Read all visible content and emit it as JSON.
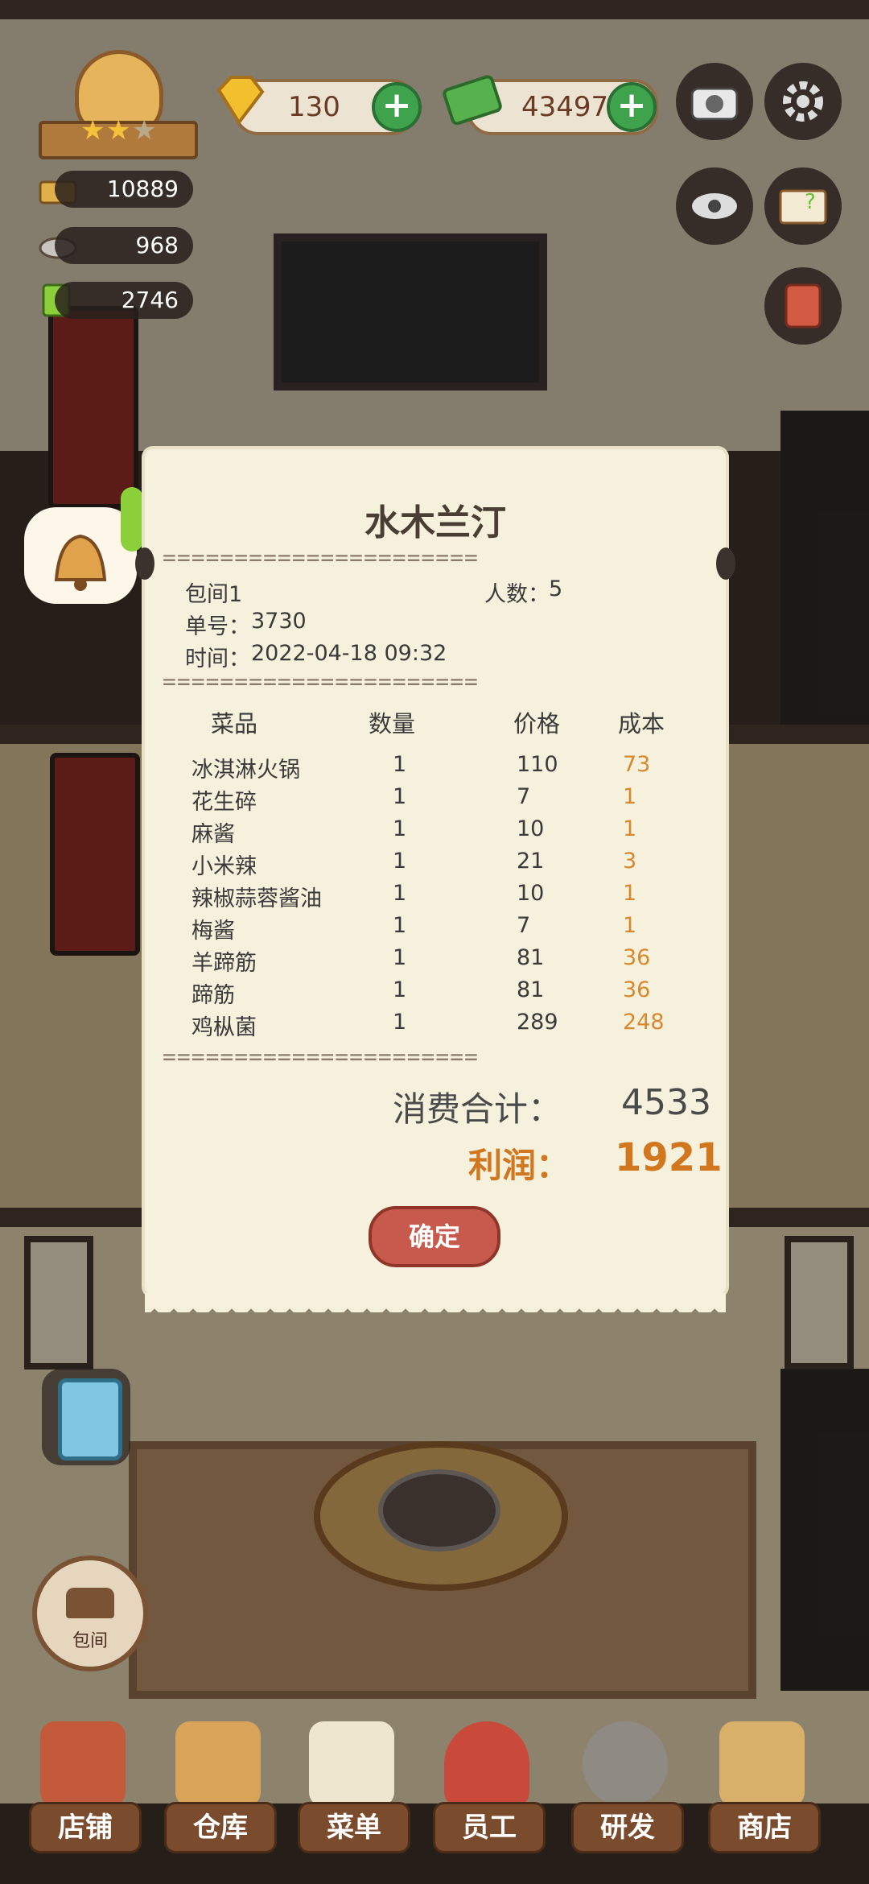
{
  "hud": {
    "gems": "130",
    "cash": "43497",
    "stats": [
      "10889",
      "968",
      "2746"
    ]
  },
  "receipt": {
    "title": "水木兰汀",
    "divider": "======================",
    "room": "包间1",
    "guests_label": "人数：",
    "guests": "5",
    "order_label": "单号：",
    "order_no": "3730",
    "time_label": "时间：",
    "time": "2022-04-18 09:32",
    "columns": [
      "菜品",
      "数量",
      "价格",
      "成本"
    ],
    "items": [
      {
        "name": "冰淇淋火锅",
        "qty": "1",
        "price": "110",
        "cost": "73"
      },
      {
        "name": "花生碎",
        "qty": "1",
        "price": "7",
        "cost": "1"
      },
      {
        "name": "麻酱",
        "qty": "1",
        "price": "10",
        "cost": "1"
      },
      {
        "name": "小米辣",
        "qty": "1",
        "price": "21",
        "cost": "3"
      },
      {
        "name": "辣椒蒜蓉酱油",
        "qty": "1",
        "price": "10",
        "cost": "1"
      },
      {
        "name": "梅酱",
        "qty": "1",
        "price": "7",
        "cost": "1"
      },
      {
        "name": "羊蹄筋",
        "qty": "1",
        "price": "81",
        "cost": "36"
      },
      {
        "name": "蹄筋",
        "qty": "1",
        "price": "81",
        "cost": "36"
      },
      {
        "name": "鸡枞菌",
        "qty": "1",
        "price": "289",
        "cost": "248"
      }
    ],
    "total_label": "消费合计：",
    "total": "4533",
    "profit_label": "利润：",
    "profit": "1921",
    "confirm": "确定"
  },
  "side": {
    "room_button": "包间"
  },
  "nav": [
    "店铺",
    "仓库",
    "菜单",
    "员工",
    "研发",
    "商店"
  ],
  "colors": {
    "cost": "#d8882f",
    "profit": "#d0771f",
    "confirm": "#c85a4d",
    "plus": "#3fa34d"
  }
}
